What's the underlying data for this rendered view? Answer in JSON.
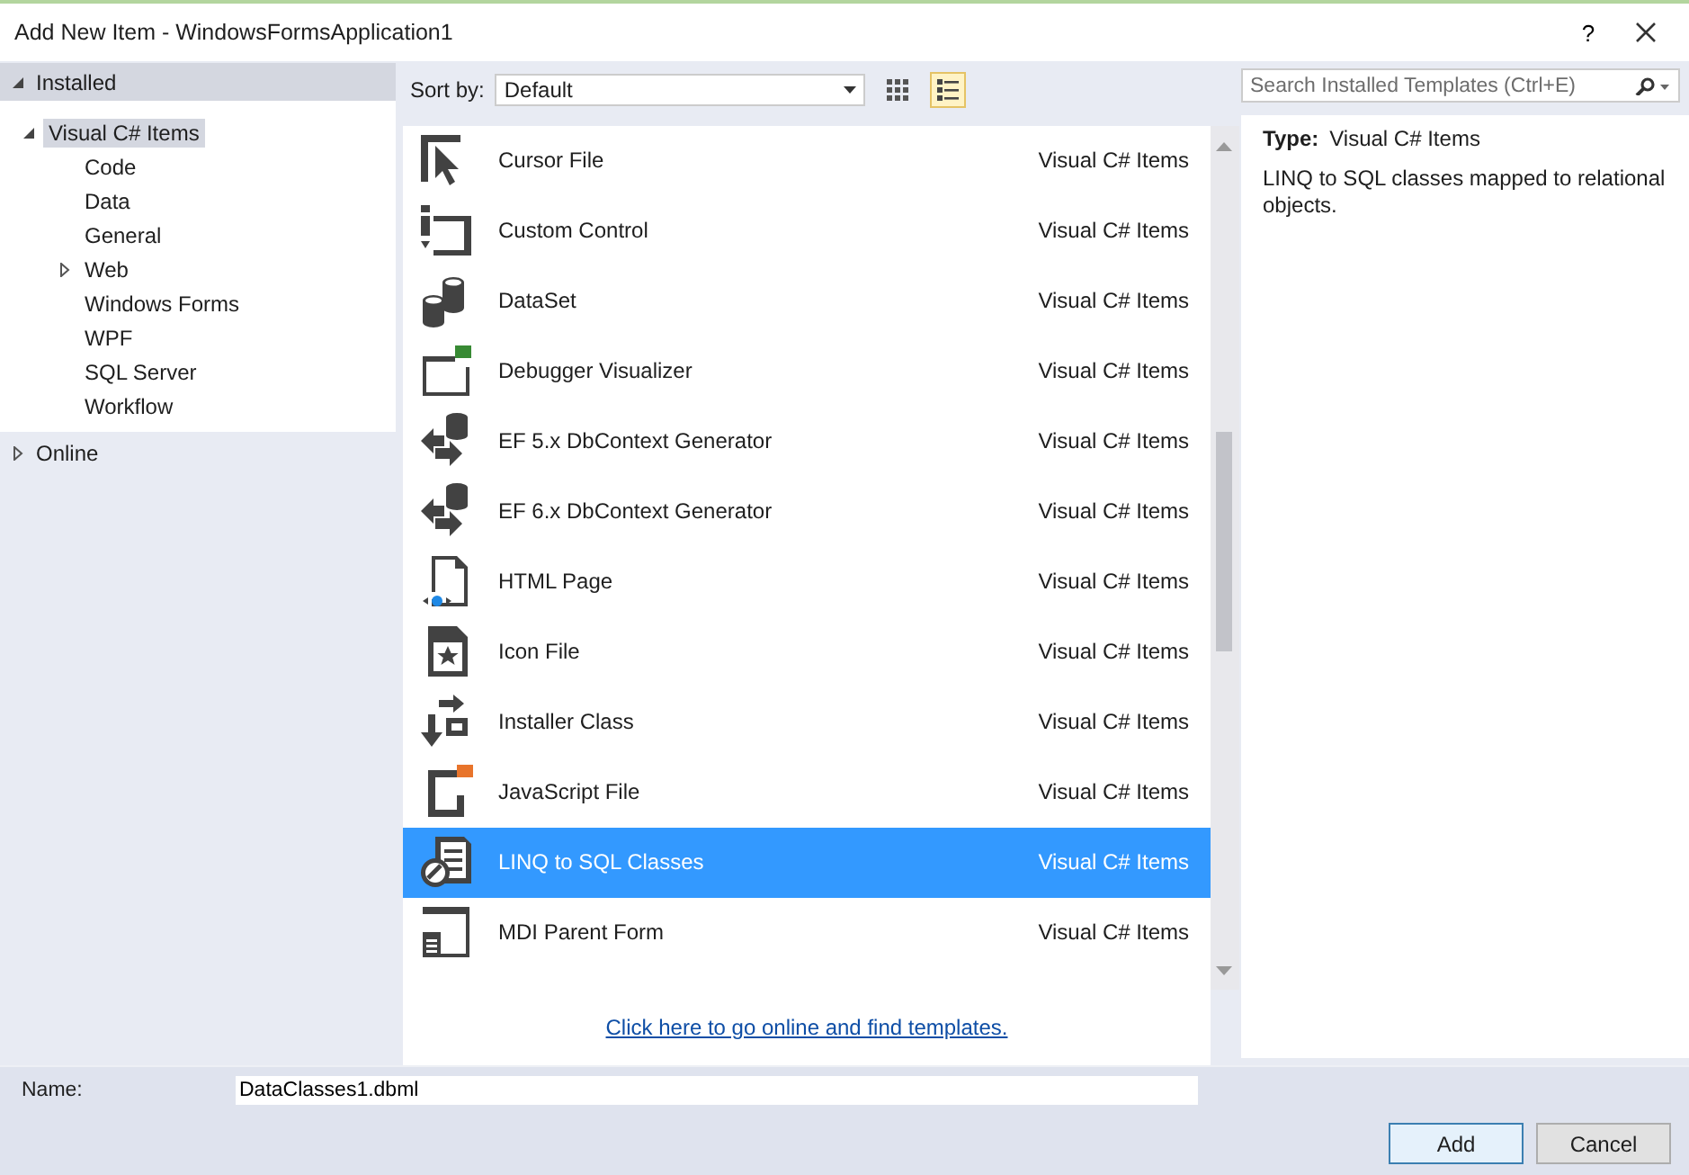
{
  "window": {
    "title": "Add New Item - WindowsFormsApplication1",
    "help": "?"
  },
  "tree": [
    {
      "label": "Installed",
      "kind": "header",
      "expanded": true,
      "children": [
        {
          "label": "Visual C# Items",
          "expanded": true,
          "selected": true,
          "children": [
            {
              "label": "Code",
              "selected": false
            },
            {
              "label": "Data",
              "selected": false
            },
            {
              "label": "General",
              "selected": false
            },
            {
              "label": "Web",
              "selected": false,
              "expanded": false
            },
            {
              "label": "Windows Forms",
              "selected": false
            },
            {
              "label": "WPF",
              "selected": false
            },
            {
              "label": "SQL Server",
              "selected": false
            },
            {
              "label": "Workflow",
              "selected": false
            }
          ]
        }
      ]
    },
    {
      "label": "Online",
      "kind": "header",
      "expanded": false
    }
  ],
  "toolbar": {
    "sort_label": "Sort by:",
    "sort_value": "Default",
    "views": [
      {
        "kind": "grid",
        "selected": false
      },
      {
        "kind": "list",
        "selected": true
      }
    ]
  },
  "search": {
    "placeholder": "Search Installed Templates (Ctrl+E)"
  },
  "templates": [
    {
      "name": "Cursor File",
      "category": "Visual C# Items",
      "kind": "cursor",
      "selected": false
    },
    {
      "name": "Custom Control",
      "category": "Visual C# Items",
      "kind": "control",
      "selected": false
    },
    {
      "name": "DataSet",
      "category": "Visual C# Items",
      "kind": "dataset",
      "selected": false
    },
    {
      "name": "Debugger Visualizer",
      "category": "Visual C# Items",
      "kind": "visualizer",
      "selected": false
    },
    {
      "name": "EF 5.x DbContext Generator",
      "category": "Visual C# Items",
      "kind": "ef",
      "selected": false
    },
    {
      "name": "EF 6.x DbContext Generator",
      "category": "Visual C# Items",
      "kind": "ef",
      "selected": false
    },
    {
      "name": "HTML Page",
      "category": "Visual C# Items",
      "kind": "html",
      "selected": false
    },
    {
      "name": "Icon File",
      "category": "Visual C# Items",
      "kind": "iconfile",
      "selected": false
    },
    {
      "name": "Installer Class",
      "category": "Visual C# Items",
      "kind": "installer",
      "selected": false
    },
    {
      "name": "JavaScript File",
      "category": "Visual C# Items",
      "kind": "js",
      "selected": false
    },
    {
      "name": "LINQ to SQL Classes",
      "category": "Visual C# Items",
      "kind": "linq",
      "selected": true
    },
    {
      "name": "MDI Parent Form",
      "category": "Visual C# Items",
      "kind": "mdi",
      "selected": false
    }
  ],
  "online_link": "Click here to go online and find templates.",
  "details": {
    "type_label": "Type:",
    "type_value": "Visual C# Items",
    "description": "LINQ to SQL classes mapped to relational objects."
  },
  "name_field": {
    "label": "Name:",
    "value": "DataClasses1.dbml"
  },
  "buttons": [
    {
      "label": "Add",
      "kind": "default"
    },
    {
      "label": "Cancel",
      "kind": "normal"
    }
  ]
}
